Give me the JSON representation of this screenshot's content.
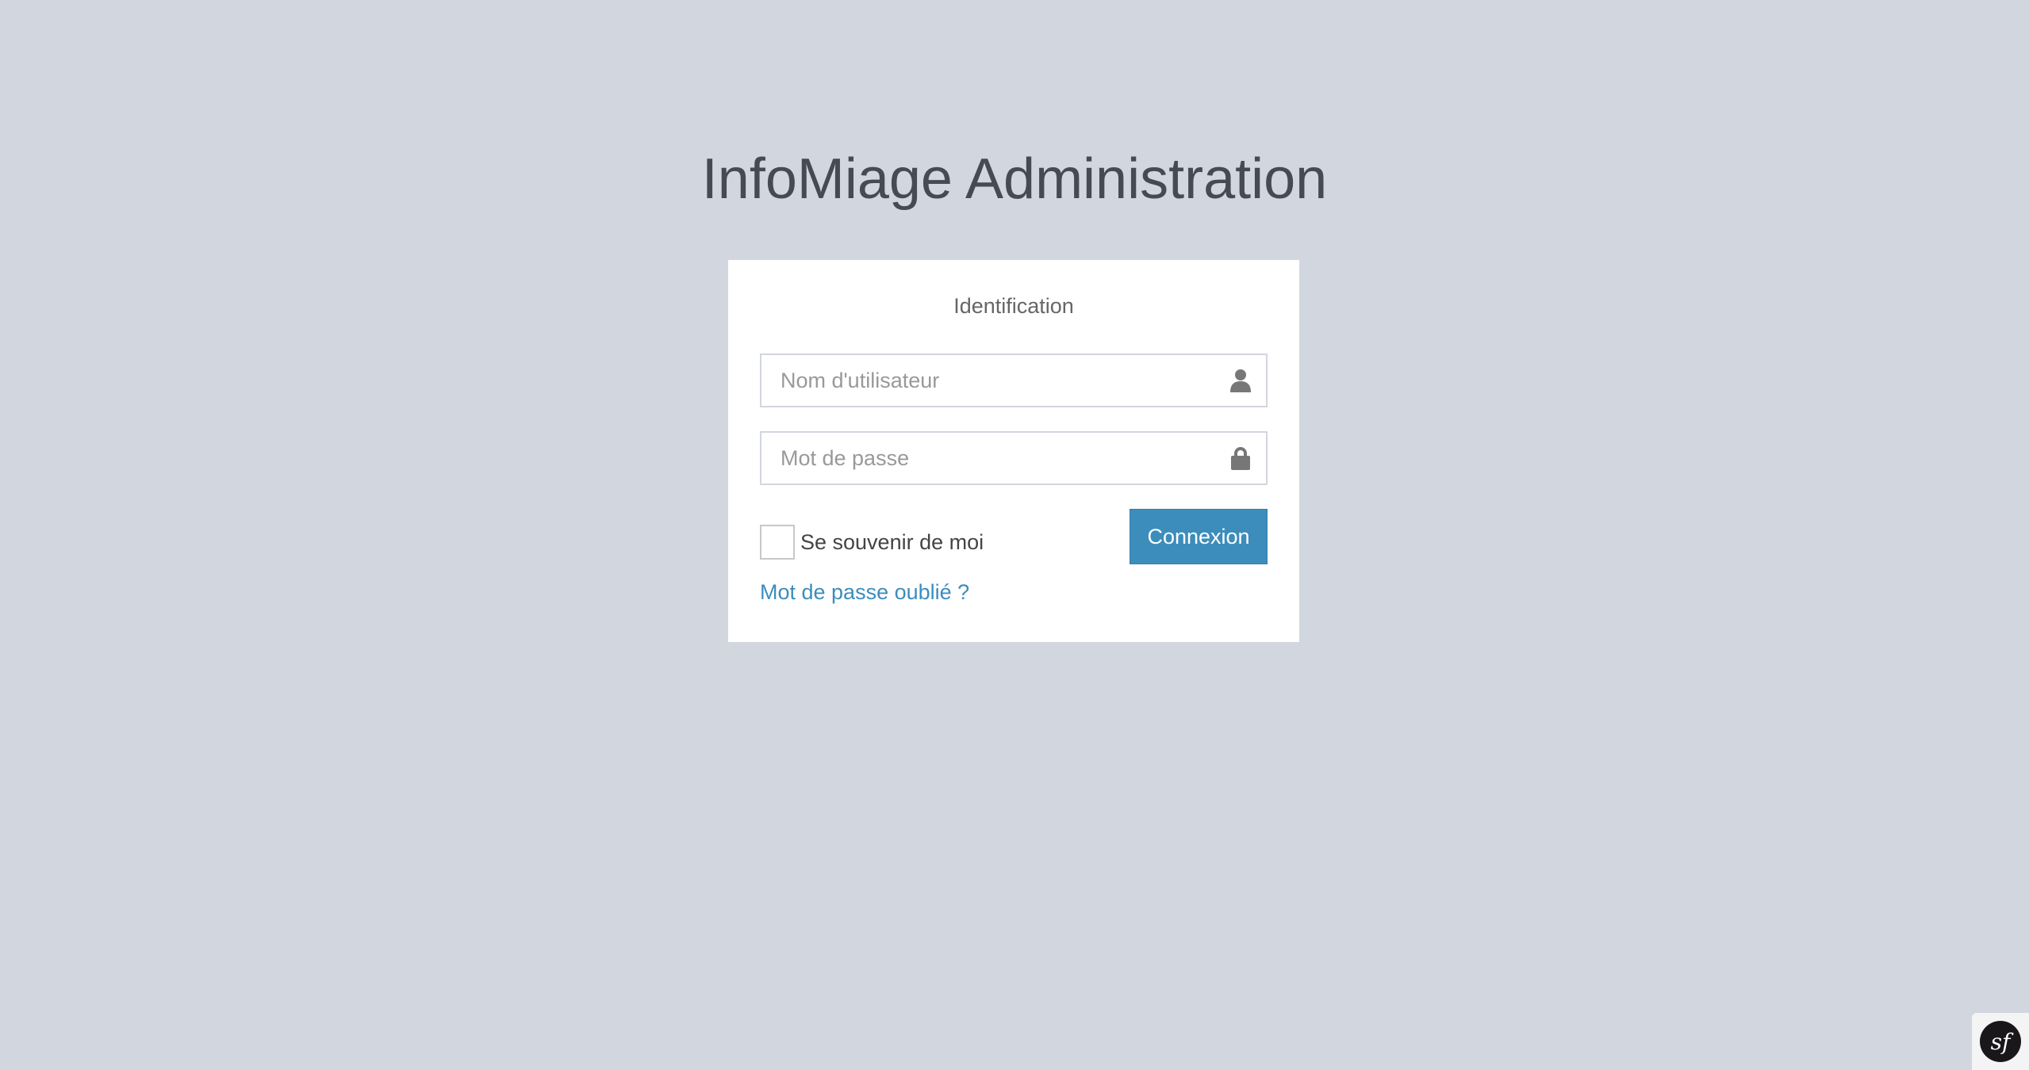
{
  "page": {
    "title": "InfoMiage Administration"
  },
  "login": {
    "box_message": "Identification",
    "username": {
      "placeholder": "Nom d'utilisateur",
      "value": "",
      "icon": "user-icon"
    },
    "password": {
      "placeholder": "Mot de passe",
      "value": "",
      "icon": "lock-icon"
    },
    "remember_label": "Se souvenir de moi",
    "remember_checked": false,
    "submit_label": "Connexion",
    "forgot_link": "Mot de passe oublié ?"
  },
  "toolbar": {
    "badge_text": "sf",
    "icon": "symfony-logo-icon"
  },
  "colors": {
    "background": "#d2d6de",
    "primary": "#3c8dbc",
    "box": "#ffffff"
  }
}
